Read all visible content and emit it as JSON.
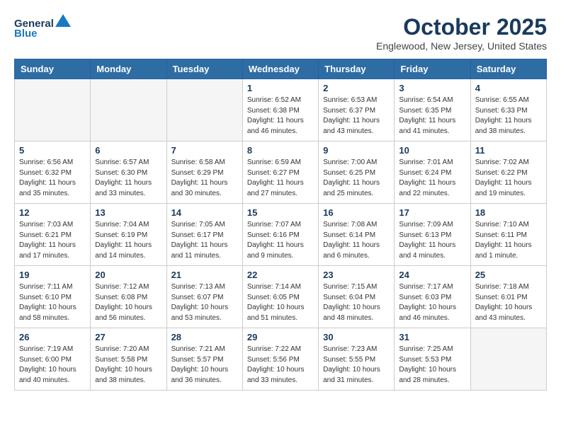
{
  "header": {
    "logo_line1": "General",
    "logo_line2": "Blue",
    "month_title": "October 2025",
    "location": "Englewood, New Jersey, United States"
  },
  "days_of_week": [
    "Sunday",
    "Monday",
    "Tuesday",
    "Wednesday",
    "Thursday",
    "Friday",
    "Saturday"
  ],
  "weeks": [
    [
      {
        "day": "",
        "info": ""
      },
      {
        "day": "",
        "info": ""
      },
      {
        "day": "",
        "info": ""
      },
      {
        "day": "1",
        "info": "Sunrise: 6:52 AM\nSunset: 6:38 PM\nDaylight: 11 hours\nand 46 minutes."
      },
      {
        "day": "2",
        "info": "Sunrise: 6:53 AM\nSunset: 6:37 PM\nDaylight: 11 hours\nand 43 minutes."
      },
      {
        "day": "3",
        "info": "Sunrise: 6:54 AM\nSunset: 6:35 PM\nDaylight: 11 hours\nand 41 minutes."
      },
      {
        "day": "4",
        "info": "Sunrise: 6:55 AM\nSunset: 6:33 PM\nDaylight: 11 hours\nand 38 minutes."
      }
    ],
    [
      {
        "day": "5",
        "info": "Sunrise: 6:56 AM\nSunset: 6:32 PM\nDaylight: 11 hours\nand 35 minutes."
      },
      {
        "day": "6",
        "info": "Sunrise: 6:57 AM\nSunset: 6:30 PM\nDaylight: 11 hours\nand 33 minutes."
      },
      {
        "day": "7",
        "info": "Sunrise: 6:58 AM\nSunset: 6:29 PM\nDaylight: 11 hours\nand 30 minutes."
      },
      {
        "day": "8",
        "info": "Sunrise: 6:59 AM\nSunset: 6:27 PM\nDaylight: 11 hours\nand 27 minutes."
      },
      {
        "day": "9",
        "info": "Sunrise: 7:00 AM\nSunset: 6:25 PM\nDaylight: 11 hours\nand 25 minutes."
      },
      {
        "day": "10",
        "info": "Sunrise: 7:01 AM\nSunset: 6:24 PM\nDaylight: 11 hours\nand 22 minutes."
      },
      {
        "day": "11",
        "info": "Sunrise: 7:02 AM\nSunset: 6:22 PM\nDaylight: 11 hours\nand 19 minutes."
      }
    ],
    [
      {
        "day": "12",
        "info": "Sunrise: 7:03 AM\nSunset: 6:21 PM\nDaylight: 11 hours\nand 17 minutes."
      },
      {
        "day": "13",
        "info": "Sunrise: 7:04 AM\nSunset: 6:19 PM\nDaylight: 11 hours\nand 14 minutes."
      },
      {
        "day": "14",
        "info": "Sunrise: 7:05 AM\nSunset: 6:17 PM\nDaylight: 11 hours\nand 11 minutes."
      },
      {
        "day": "15",
        "info": "Sunrise: 7:07 AM\nSunset: 6:16 PM\nDaylight: 11 hours\nand 9 minutes."
      },
      {
        "day": "16",
        "info": "Sunrise: 7:08 AM\nSunset: 6:14 PM\nDaylight: 11 hours\nand 6 minutes."
      },
      {
        "day": "17",
        "info": "Sunrise: 7:09 AM\nSunset: 6:13 PM\nDaylight: 11 hours\nand 4 minutes."
      },
      {
        "day": "18",
        "info": "Sunrise: 7:10 AM\nSunset: 6:11 PM\nDaylight: 11 hours\nand 1 minute."
      }
    ],
    [
      {
        "day": "19",
        "info": "Sunrise: 7:11 AM\nSunset: 6:10 PM\nDaylight: 10 hours\nand 58 minutes."
      },
      {
        "day": "20",
        "info": "Sunrise: 7:12 AM\nSunset: 6:08 PM\nDaylight: 10 hours\nand 56 minutes."
      },
      {
        "day": "21",
        "info": "Sunrise: 7:13 AM\nSunset: 6:07 PM\nDaylight: 10 hours\nand 53 minutes."
      },
      {
        "day": "22",
        "info": "Sunrise: 7:14 AM\nSunset: 6:05 PM\nDaylight: 10 hours\nand 51 minutes."
      },
      {
        "day": "23",
        "info": "Sunrise: 7:15 AM\nSunset: 6:04 PM\nDaylight: 10 hours\nand 48 minutes."
      },
      {
        "day": "24",
        "info": "Sunrise: 7:17 AM\nSunset: 6:03 PM\nDaylight: 10 hours\nand 46 minutes."
      },
      {
        "day": "25",
        "info": "Sunrise: 7:18 AM\nSunset: 6:01 PM\nDaylight: 10 hours\nand 43 minutes."
      }
    ],
    [
      {
        "day": "26",
        "info": "Sunrise: 7:19 AM\nSunset: 6:00 PM\nDaylight: 10 hours\nand 40 minutes."
      },
      {
        "day": "27",
        "info": "Sunrise: 7:20 AM\nSunset: 5:58 PM\nDaylight: 10 hours\nand 38 minutes."
      },
      {
        "day": "28",
        "info": "Sunrise: 7:21 AM\nSunset: 5:57 PM\nDaylight: 10 hours\nand 36 minutes."
      },
      {
        "day": "29",
        "info": "Sunrise: 7:22 AM\nSunset: 5:56 PM\nDaylight: 10 hours\nand 33 minutes."
      },
      {
        "day": "30",
        "info": "Sunrise: 7:23 AM\nSunset: 5:55 PM\nDaylight: 10 hours\nand 31 minutes."
      },
      {
        "day": "31",
        "info": "Sunrise: 7:25 AM\nSunset: 5:53 PM\nDaylight: 10 hours\nand 28 minutes."
      },
      {
        "day": "",
        "info": ""
      }
    ]
  ]
}
